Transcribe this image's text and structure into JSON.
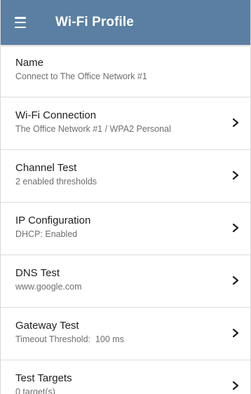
{
  "appbar": {
    "title": "Wi-Fi Profile",
    "menu_icon": "hamburger-menu-icon",
    "color": "#5a7fa3"
  },
  "items": [
    {
      "label": "Name",
      "value": "Connect to The Office Network #1",
      "chevron": false
    },
    {
      "label": "Wi-Fi Connection",
      "value": "The Office Network #1 / WPA2 Personal",
      "chevron": true
    },
    {
      "label": "Channel Test",
      "value": "2 enabled thresholds",
      "chevron": true
    },
    {
      "label": "IP Configuration",
      "value": "DHCP: Enabled",
      "chevron": true
    },
    {
      "label": "DNS Test",
      "value": "www.google.com",
      "chevron": true
    },
    {
      "label": "Gateway Test",
      "value": "Timeout Threshold:  100 ms",
      "chevron": true
    },
    {
      "label": "Test Targets",
      "value": "0 target(s)",
      "chevron": true
    }
  ]
}
